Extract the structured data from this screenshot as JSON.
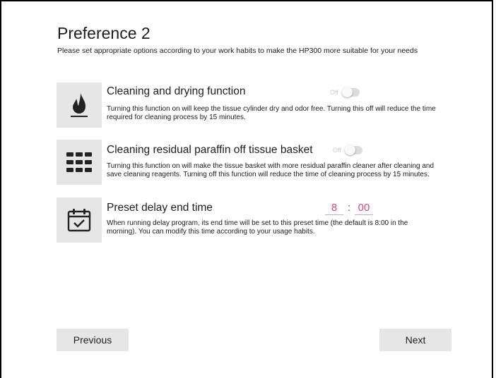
{
  "page": {
    "title": "Preference 2",
    "subtitle": "Please set appropriate options according to your work habits to make the HP300 more suitable for your needs"
  },
  "options": [
    {
      "title": "Cleaning and drying function",
      "description": "Turning this function on will keep the tissue cylinder dry and odor free. Turning this off will reduce the time required for cleaning process by 15 minutes.",
      "toggle_label": "Off",
      "state": "off",
      "icon": "flame-icon"
    },
    {
      "title": "Cleaning residual paraffin off tissue basket",
      "description": "Turning this function on will make the tissue basket with more residual paraffin cleaner after cleaning and save cleaning reagents. Turning off this function will reduce the time of cleaning process by 15 minutes.",
      "toggle_label": "Off",
      "state": "off",
      "icon": "grid-icon"
    },
    {
      "title": "Preset delay end time",
      "description": "When running delay program, its end time will be set to this preset time (the default is 8:00 in the morning). You can modify this time according to your usage habits.",
      "hour": "8",
      "separator": ":",
      "minute": "00",
      "icon": "calendar-check-icon"
    }
  ],
  "buttons": {
    "previous": "Previous",
    "next": "Next"
  },
  "colors": {
    "accent_time": "#e2457a",
    "icon_bg": "#e6e6e6",
    "button_bg": "#e6e6e6",
    "toggle_off_label": "#c9c9c9"
  }
}
